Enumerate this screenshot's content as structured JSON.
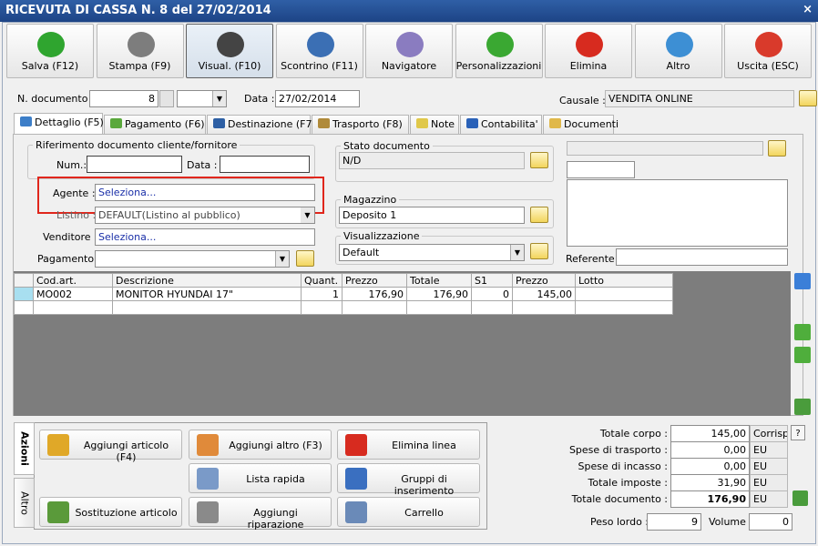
{
  "window": {
    "title": "RICEVUTA DI CASSA N. 8 del 27/02/2014",
    "close": "×"
  },
  "toolbar": [
    {
      "label": "Salva (F12)",
      "icon": "check-icon",
      "color": "#2fa52f"
    },
    {
      "label": "Stampa (F9)",
      "icon": "printer-icon",
      "color": "#7d7d7d"
    },
    {
      "label": "Visual. (F10)",
      "icon": "magic-wand-icon",
      "color": "#444444"
    },
    {
      "label": "Scontrino (F11)",
      "icon": "cash-register-icon",
      "color": "#3b6fb4"
    },
    {
      "label": "Navigatore",
      "icon": "compass-icon",
      "color": "#8a7cc0"
    },
    {
      "label": "Personalizzazioni",
      "icon": "puzzle-icon",
      "color": "#3aa832"
    },
    {
      "label": "Elimina",
      "icon": "red-x-icon",
      "color": "#d72b1f"
    },
    {
      "label": "Altro",
      "icon": "magnifier-icon",
      "color": "#3d8fd4"
    },
    {
      "label": "Uscita (ESC)",
      "icon": "power-icon",
      "color": "#d93a2b"
    }
  ],
  "header": {
    "ndoc_label": "N. documento :",
    "ndoc_value": "8",
    "ndoc_suffix": "",
    "data_label": "Data :",
    "data_value": "27/02/2014",
    "causale_label": "Causale :",
    "causale_value": "VENDITA ONLINE"
  },
  "tabs": [
    {
      "label": "Dettaglio (F5)",
      "color": "#3c7ec8"
    },
    {
      "label": "Pagamento (F6)",
      "color": "#5aa83c"
    },
    {
      "label": "Destinazione (F7)",
      "color": "#2d5fa4"
    },
    {
      "label": "Trasporto (F8)",
      "color": "#b08a3a"
    },
    {
      "label": "Note",
      "color": "#e0c84a"
    },
    {
      "label": "Contabilita'",
      "color": "#2b62b8"
    },
    {
      "label": "Documenti",
      "color": "#e0b84a"
    }
  ],
  "dettaglio": {
    "rif_title": "Riferimento documento cliente/fornitore",
    "num_label": "Num.:",
    "num_value": "",
    "rif_data_label": "Data :",
    "rif_data_value": "",
    "agente_label": "Agente :",
    "agente_value": "Seleziona...",
    "listino_label": "Listino :",
    "listino_value": "DEFAULT(Listino al pubblico)",
    "venditore_label": "Venditore :",
    "venditore_value": "Seleziona...",
    "pagamento_label": "Pagamento :",
    "pagamento_value": "",
    "stato_title": "Stato documento",
    "stato_value": "N/D",
    "magazzino_title": "Magazzino",
    "magazzino_value": "Deposito 1",
    "visual_title": "Visualizzazione",
    "visual_value": "Default",
    "referente_label": "Referente",
    "referente_value": ""
  },
  "grid": {
    "columns": [
      "Cod.art.",
      "Descrizione",
      "Quant.",
      "Prezzo",
      "Totale",
      "S1",
      "Prezzo",
      "Lotto"
    ],
    "rows": [
      [
        "MO002",
        "MONITOR HYUNDAI 17\"",
        "1",
        "176,90",
        "176,90",
        "0",
        "145,00",
        ""
      ],
      [
        "",
        "",
        "",
        "",
        "",
        "",
        "",
        ""
      ]
    ]
  },
  "actions": {
    "side_tabs": [
      "Azioni",
      "Altro"
    ],
    "buttons": [
      {
        "label": "Aggiungi articolo (F4)",
        "icon": "add-box-icon",
        "color": "#e0a828"
      },
      {
        "label": "Aggiungi altro (F3)",
        "icon": "add-grid-icon",
        "color": "#e08a3a"
      },
      {
        "label": "Elimina linea",
        "icon": "red-x-icon",
        "color": "#d72b1f"
      },
      {
        "label": "Lista rapida",
        "icon": "quick-list-icon",
        "color": "#7a9ac8"
      },
      {
        "label": "Gruppi di inserimento",
        "icon": "group-add-icon",
        "color": "#3a6fc0"
      },
      {
        "label": "Sostituzione articolo",
        "icon": "swap-icon",
        "color": "#5a9a3a"
      },
      {
        "label": "Aggiungi riparazione",
        "icon": "wrench-icon",
        "color": "#8a8a8a"
      },
      {
        "label": "Carrello",
        "icon": "cart-icon",
        "color": "#6a8ab8"
      }
    ]
  },
  "totals": {
    "corpo_label": "Totale corpo :",
    "corpo_value": "145,00",
    "corrisp": "Corrisp.",
    "help": "?",
    "trasporto_label": "Spese di trasporto :",
    "trasporto_value": "0,00",
    "incasso_label": "Spese di incasso :",
    "incasso_value": "0,00",
    "imposte_label": "Totale imposte :",
    "imposte_value": "31,90",
    "documento_label": "Totale documento :",
    "documento_value": "176,90",
    "currency": "EU",
    "peso_label": "Peso lordo :",
    "peso_value": "9",
    "volume_label": "Volume :",
    "volume_value": "0"
  }
}
